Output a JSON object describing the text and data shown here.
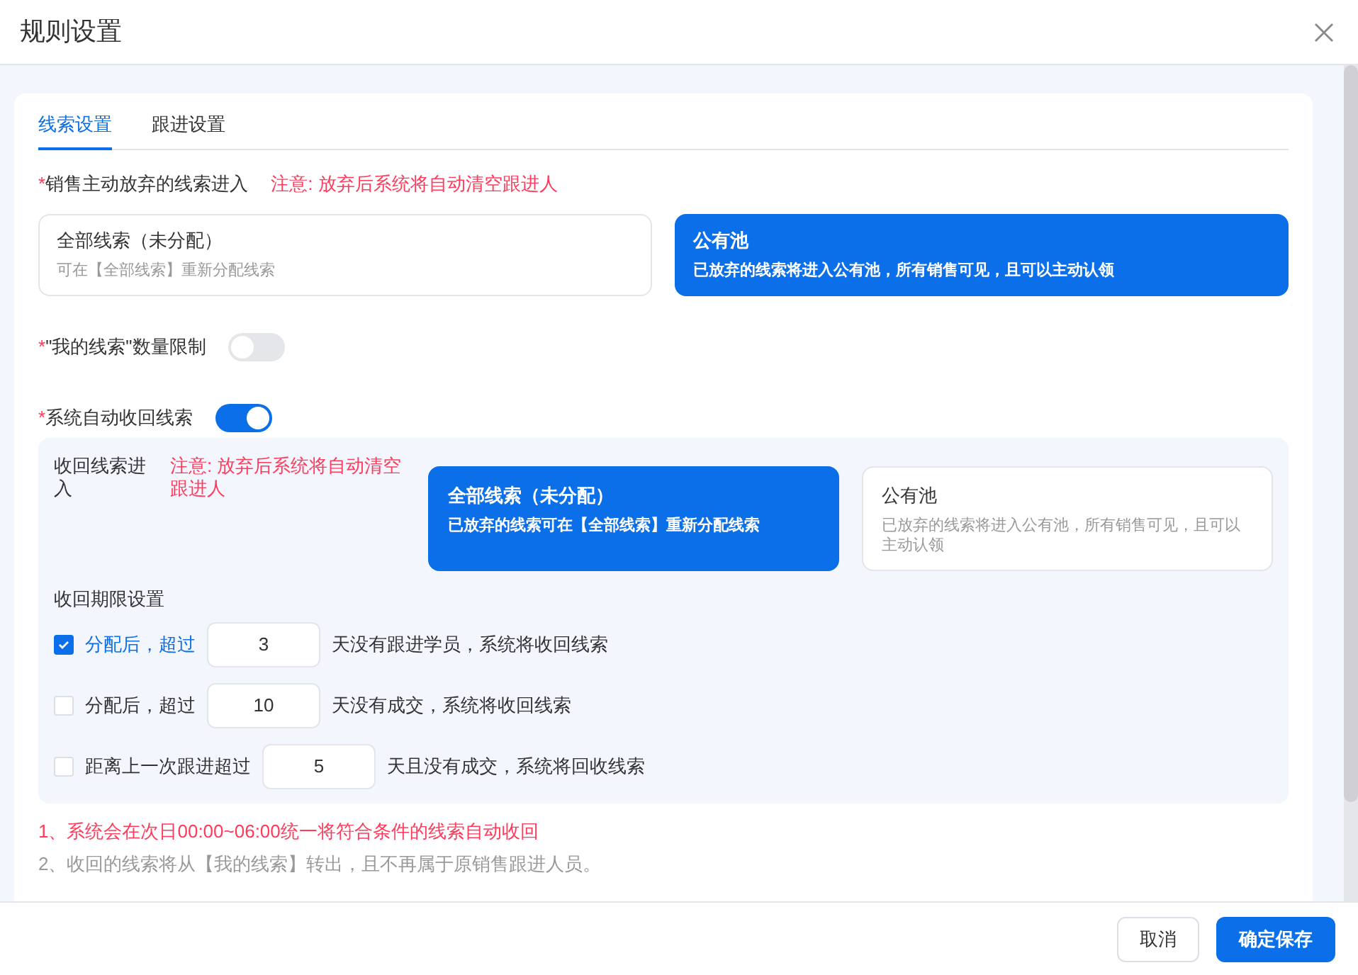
{
  "window": {
    "title": "规则设置"
  },
  "tabs": [
    {
      "label": "线索设置",
      "selected": true
    },
    {
      "label": "跟进设置",
      "selected": false
    }
  ],
  "abandon": {
    "required_mark": "*",
    "label": "销售主动放弃的线索进入",
    "note": "注意: 放弃后系统将自动清空跟进人",
    "options": [
      {
        "title": "全部线索（未分配）",
        "description": "可在【全部线索】重新分配线索",
        "selected": false
      },
      {
        "title": "公有池",
        "description": "已放弃的线索将进入公有池，所有销售可见，且可以主动认领",
        "selected": true
      }
    ]
  },
  "limit": {
    "required_mark": "*",
    "label": "\"我的线索\"数量限制",
    "on": false
  },
  "auto_recall": {
    "required_mark": "*",
    "label": "系统自动收回线索",
    "on": true,
    "target_label": "收回线索进入",
    "note": "注意: 放弃后系统将自动清空跟进人",
    "options": [
      {
        "title": "全部线索（未分配）",
        "description": "已放弃的线索可在【全部线索】重新分配线索",
        "selected": true
      },
      {
        "title": "公有池",
        "description": "已放弃的线索将进入公有池，所有销售可见，且可以主动认领",
        "selected": false
      }
    ],
    "period_label": "收回期限设置",
    "rules": [
      {
        "checked": true,
        "before": "分配后，超过",
        "value": "3",
        "after": "天没有跟进学员，系统将收回线索"
      },
      {
        "checked": false,
        "before": "分配后，超过",
        "value": "10",
        "after": "天没有成交，系统将收回线索"
      },
      {
        "checked": false,
        "before": "距离上一次跟进超过",
        "value": "5",
        "after": "天且没有成交，系统将回收线索"
      }
    ]
  },
  "notes": [
    {
      "kind": "warning",
      "text": "1、系统会在次日00:00~06:00统一将符合条件的线索自动收回"
    },
    {
      "kind": "info",
      "text": "2、收回的线索将从【我的线索】转出，且不再属于原销售跟进人员。"
    }
  ],
  "buttons": [
    {
      "kind": "secondary",
      "label": "取消"
    },
    {
      "kind": "primary",
      "label": "确定保存"
    }
  ]
}
